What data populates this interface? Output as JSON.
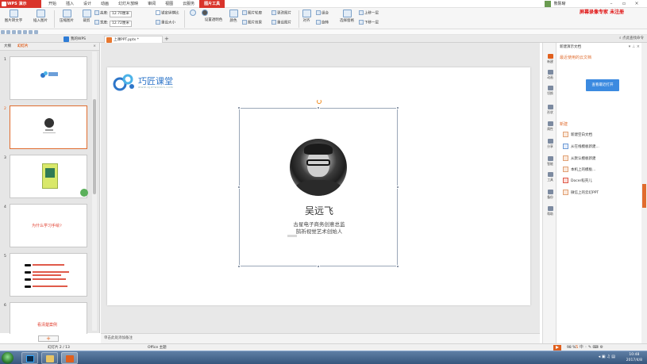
{
  "app": {
    "logo_label": "WPS 演示"
  },
  "menus": [
    "开始",
    "插入",
    "设计",
    "动画",
    "幻灯片放映",
    "审阅",
    "视图",
    "云服务",
    "图片工具"
  ],
  "active_menu_index": 8,
  "user": {
    "name": "熊陈晰"
  },
  "watermark": "屏幕录像专家 未注册",
  "ribbon": {
    "btn_extract_text": "图片转文字",
    "btn_insert_picture": "插入图片",
    "btn_compress": "压缩图片",
    "btn_crop": "裁剪",
    "height_label": "高度:",
    "height_value": "12.70厘米",
    "width_label": "宽度:",
    "width_value": "12.72厘米",
    "lock_ratio": "锁定纵横比",
    "reset_size": "重设大小",
    "transparent_color": "设置透明色",
    "color": "颜色",
    "picture_outline": "图片轮廓",
    "picture_effect": "图片效果",
    "change_picture": "更改图片",
    "reset_picture": "重设图片",
    "align": "对齐",
    "group": "组合",
    "rotate": "旋转",
    "select_pane": "选择窗格",
    "bring_forward": "上移一层",
    "send_backward": "下移一层"
  },
  "tabs": [
    {
      "label": "我的WPS"
    },
    {
      "label": "上课PPT.pptx *"
    }
  ],
  "tab_right_text": "点此查找命令",
  "left_panel": {
    "tab_outline": "大纲",
    "tab_slides": "幻灯片",
    "close": "×",
    "slide_numbers": [
      "1",
      "2",
      "3",
      "4",
      "5",
      "6"
    ],
    "slide4_text": "为什么学习手绘?",
    "slide6_text": "看清楚案例"
  },
  "add_slide": "+",
  "slide": {
    "logo_text": "巧匠课堂",
    "logo_sub": "WWW.QJKTWORKS.COM",
    "name": "吴远飞",
    "title1": "古星电子商务创意总监",
    "title2": "鹄祈视觉艺术创始人"
  },
  "notes_placeholder": "单击此处添加备注",
  "right_panel": {
    "title": "新建演示文档",
    "recent_label": "最近使用的云文档",
    "view_recent_btn": "查看最近打开",
    "new_label": "新建",
    "items": [
      "新建空白文档",
      "从在线模板新建...",
      "从默认模板新建",
      "本机上的模板...",
      "Docer稻壳儿",
      "微信上的云幻PPT"
    ]
  },
  "right_strip": [
    "新建",
    "动画",
    "切换",
    "形状",
    "属性",
    "分享",
    "智能",
    "工具",
    "备份",
    "帮助"
  ],
  "status": {
    "slide_info": "幻灯片 2 / 13",
    "theme": "Office 主题",
    "zoom": "98 %"
  },
  "taskbar": {
    "time": "10:48",
    "date": "2017/4/8"
  },
  "colors": {
    "accent": "#d9342b",
    "orange": "#e0601e",
    "blue": "#3b8ae0"
  }
}
